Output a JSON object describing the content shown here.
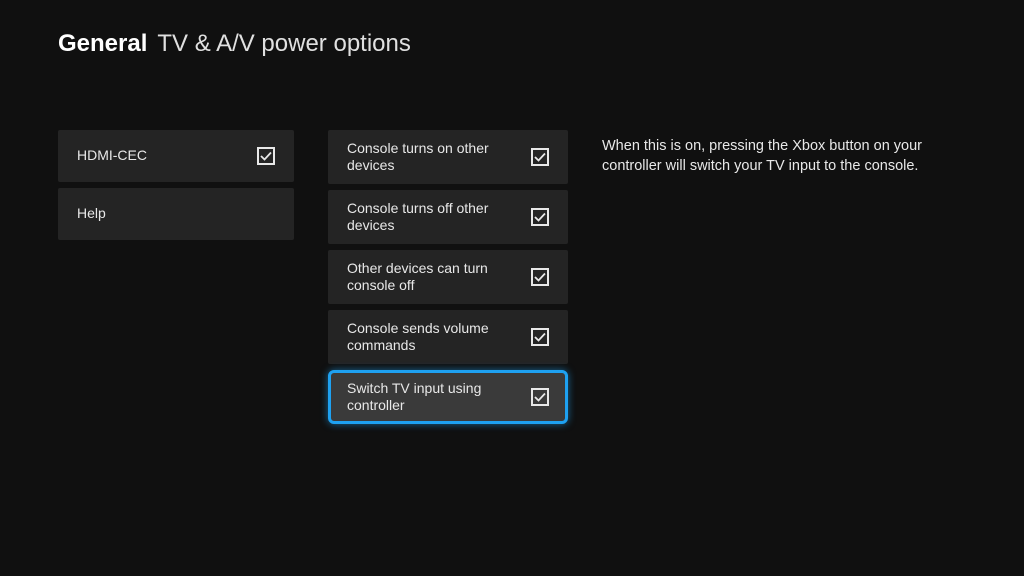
{
  "header": {
    "category": "General",
    "title": "TV & A/V power options"
  },
  "left_column": [
    {
      "label": "HDMI-CEC",
      "checked": true
    },
    {
      "label": "Help",
      "checked": null
    }
  ],
  "mid_column": [
    {
      "label": "Console turns on other devices",
      "checked": true,
      "selected": false
    },
    {
      "label": "Console turns off other devices",
      "checked": true,
      "selected": false
    },
    {
      "label": "Other devices can turn console off",
      "checked": true,
      "selected": false
    },
    {
      "label": "Console sends volume commands",
      "checked": true,
      "selected": false
    },
    {
      "label": "Switch TV input using controller",
      "checked": true,
      "selected": true
    }
  ],
  "description": "When this is on, pressing the Xbox button on your controller will switch your TV input to the console."
}
